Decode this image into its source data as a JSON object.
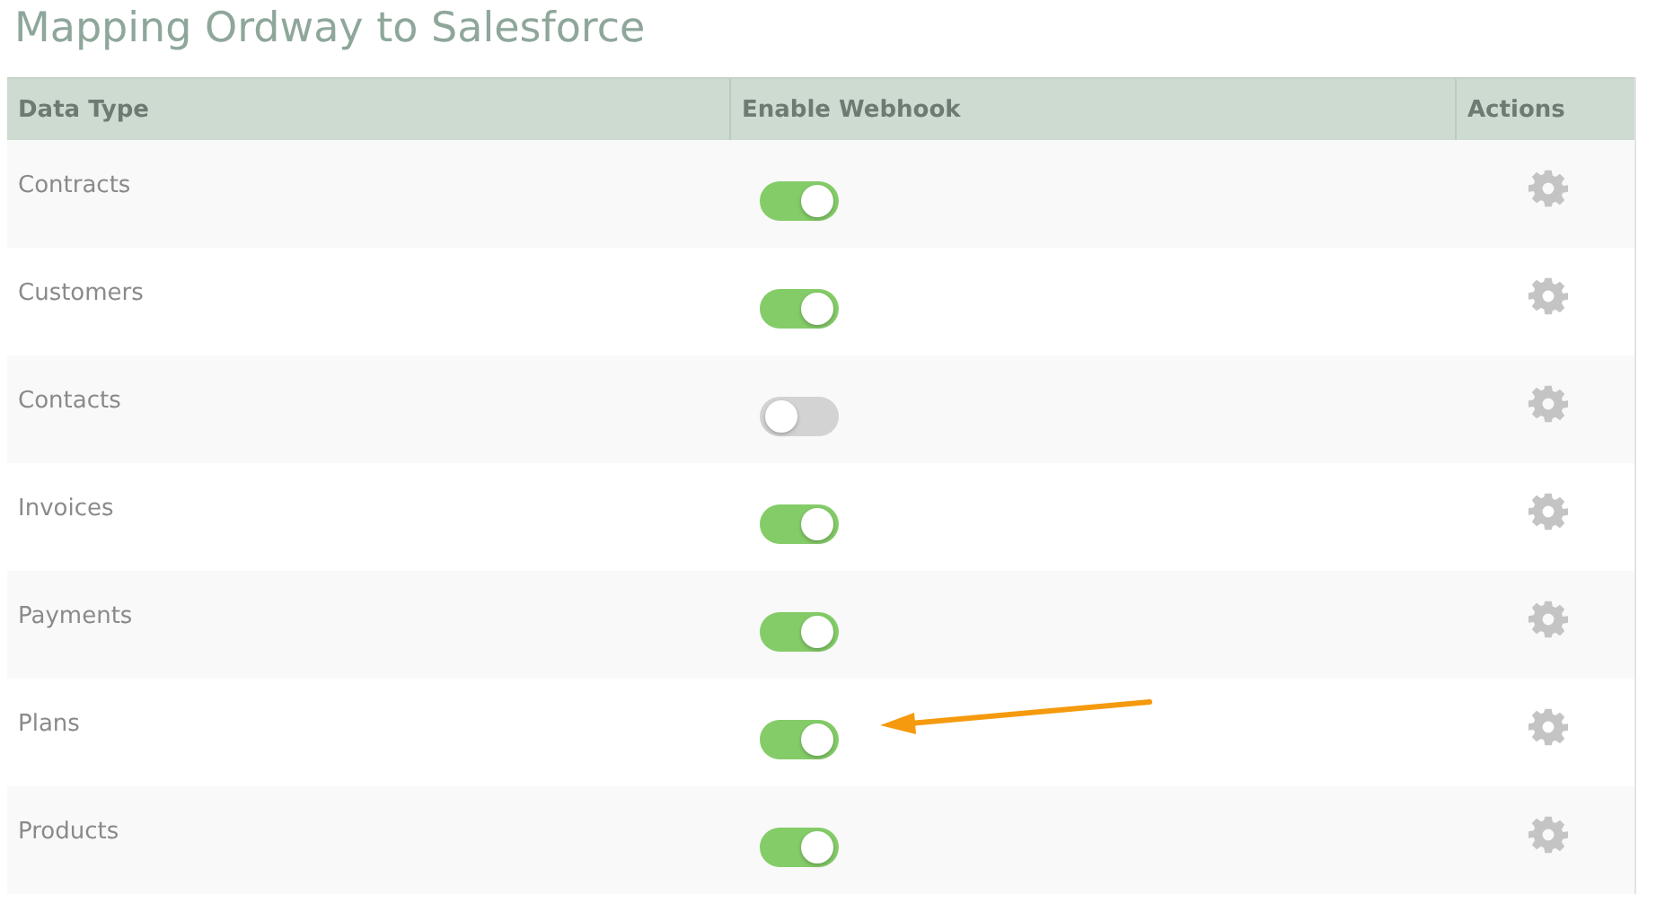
{
  "title": "Mapping Ordway to Salesforce",
  "table": {
    "columns": [
      "Data Type",
      "Enable Webhook",
      "Actions"
    ],
    "rows": [
      {
        "data_type": "Contracts",
        "webhook_on": true
      },
      {
        "data_type": "Customers",
        "webhook_on": true
      },
      {
        "data_type": "Contacts",
        "webhook_on": false
      },
      {
        "data_type": "Invoices",
        "webhook_on": true
      },
      {
        "data_type": "Payments",
        "webhook_on": true
      },
      {
        "data_type": "Plans",
        "webhook_on": true
      },
      {
        "data_type": "Products",
        "webhook_on": true
      }
    ]
  }
}
